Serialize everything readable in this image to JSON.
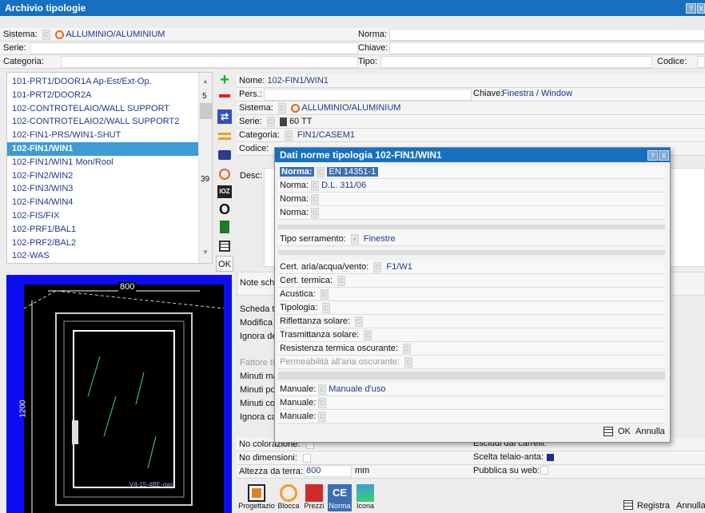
{
  "window": {
    "title": "Archivio tipologie",
    "help_btn": "?",
    "close_btn": "X"
  },
  "header": {
    "sistema_label": "Sistema:",
    "sistema_value": "ALLUMINIO/ALUMINIUM",
    "serie_label": "Serie:",
    "categoria_label": "Categoria:",
    "norma_label": "Norma:",
    "chiave_label": "Chiave:",
    "tipo_label": "Tipo:",
    "codice_label": "Codice:",
    "lock_glyph": "C"
  },
  "list": {
    "items": [
      "101-PRT1/DOOR1A Ap-Est/Ext-Op.",
      "101-PRT2/DOOR2A",
      "102-CONTROTELAIO/WALL SUPPORT",
      "102-CONTROTELAIO2/WALL SUPPORT2",
      "102-FIN1-PRS/WIN1-SHUT",
      "102-FIN1/WIN1",
      "102-FIN1/WIN1 Mon/Rool",
      "102-FIN2/WIN2",
      "102-FIN3/WIN3",
      "102-FIN4/WIN4",
      "102-FIS/FIX",
      "102-PRF1/BAL1",
      "102-PRF2/BAL2",
      "102-WAS"
    ],
    "selected_index": 5,
    "count_top": "5",
    "count_bottom": "39"
  },
  "toolbar": {
    "iq_label": "IOZ",
    "ok_label": "OK"
  },
  "drawing": {
    "width_dim": "800",
    "height_dim": "1200",
    "code": "V4-15-4BE-gas"
  },
  "detail": {
    "nome_label": "Nome:",
    "nome_value": "102-FIN1/WIN1",
    "pers_label": "Pers.:",
    "chiave_label": "Chiave:",
    "chiave_value": "Finestra / Window",
    "sistema_label": "Sistema:",
    "sistema_value": "ALLUMINIO/ALUMINIUM",
    "serie_label": "Serie:",
    "serie_value": "60 TT",
    "categoria_label": "Categoria:",
    "categoria_value": "FIN1/CASEM1",
    "codice_label": "Codice:",
    "desc_label": "Desc:",
    "note_label": "Note sche",
    "scheda_label": "Scheda tec",
    "modifica_label": "Modifica a",
    "ignora_des_label": "Ignora des",
    "fattore_label": "Fattore tip",
    "minuti_ma_label": "Minuti ma",
    "minuti_pos_label": "Minuti pos",
    "minuti_con_label": "Minuti con",
    "ignora_cal_label": "Ignora cal",
    "no_colorazione_label": "No colorazione:",
    "no_dimensioni_label": "No dimensioni:",
    "altezza_label": "Altezza da terra:",
    "altezza_value": "800",
    "altezza_unit": "mm",
    "escludi_label": "Escludi dai carrelli:",
    "scelta_label": "Scelta telaio-anta:",
    "pubblica_label": "Pubblica su web:"
  },
  "dialog": {
    "title": "Dati norme tipologia 102-FIN1/WIN1",
    "help_btn": "?",
    "close_btn": "X",
    "norme": [
      {
        "label": "Norma:",
        "value": "EN 14351-1"
      },
      {
        "label": "Norma:",
        "value": "D.L. 311/06"
      },
      {
        "label": "Norma:",
        "value": ""
      },
      {
        "label": "Norma:",
        "value": ""
      }
    ],
    "tipo_serramento_label": "Tipo serramento:",
    "tipo_serramento_value": "Finestre",
    "cert_aria_label": "Cert. aria/acqua/vento:",
    "cert_aria_value": "F1/W1",
    "cert_termica_label": "Cert. termica:",
    "acustica_label": "Acustica:",
    "tipologia_label": "Tipologia:",
    "riflettanza_label": "Riflettanza solare:",
    "trasmittanza_label": "Trasmittanza solare:",
    "resistenza_label": "Resistenza termica oscurante:",
    "permeabilita_label": "Permeabilità all'aria oscurante:",
    "manuali": [
      {
        "label": "Manuale:",
        "value": "Manuale d'uso"
      },
      {
        "label": "Manuale:",
        "value": ""
      },
      {
        "label": "Manuale:",
        "value": ""
      }
    ],
    "ok_label": "OK",
    "annulla_label": "Annulla"
  },
  "bottom_tabs": [
    "Progettazio",
    "Blocca",
    "Prezzi",
    "Norma",
    "Icona"
  ],
  "footer": {
    "registra_label": "Registra",
    "annulla_label": "Annulla"
  },
  "colors": {
    "title_bar": "#1670bf",
    "selection": "#3d9bd6",
    "value_text": "#1c3a8a",
    "drawing_bg": "#0d0df2"
  }
}
